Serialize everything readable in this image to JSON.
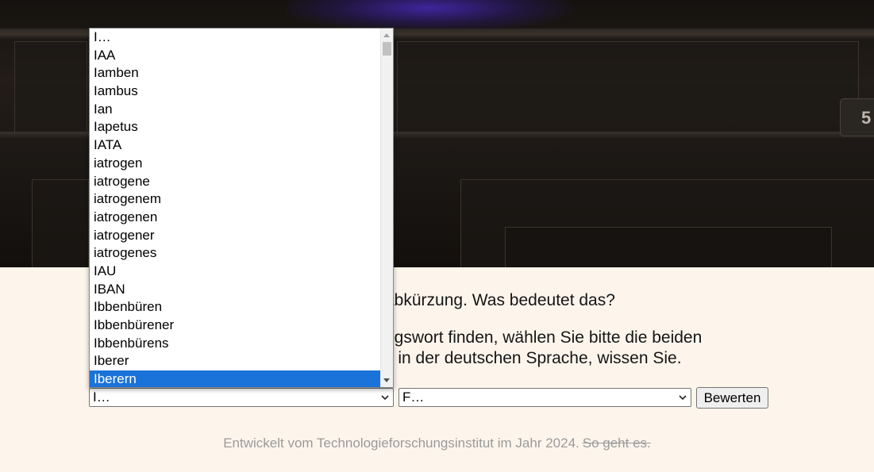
{
  "hero": {
    "sign_number": "5"
  },
  "prompt": {
    "line1": "abkürzung. Was bedeutet das?",
    "line2a": "ngswort finden, wählen Sie bitte die beiden",
    "line2b": "s in der deutschen Sprache, wissen Sie."
  },
  "form": {
    "select1_value": "I…",
    "select2_value": "F…",
    "submit_label": "Bewerten"
  },
  "dropdown": {
    "options": [
      "I…",
      "IAA",
      "Iamben",
      "Iambus",
      "Ian",
      "Iapetus",
      "IATA",
      "iatrogen",
      "iatrogene",
      "iatrogenem",
      "iatrogenen",
      "iatrogener",
      "iatrogenes",
      "IAU",
      "IBAN",
      "Ibbenbüren",
      "Ibbenbürener",
      "Ibbenbürens",
      "Iberer",
      "Iberern"
    ],
    "selected_index": 19
  },
  "footer": {
    "text": "Entwickelt vom Technologieforschungsinstitut im Jahr 2024.",
    "link": "So geht es."
  }
}
